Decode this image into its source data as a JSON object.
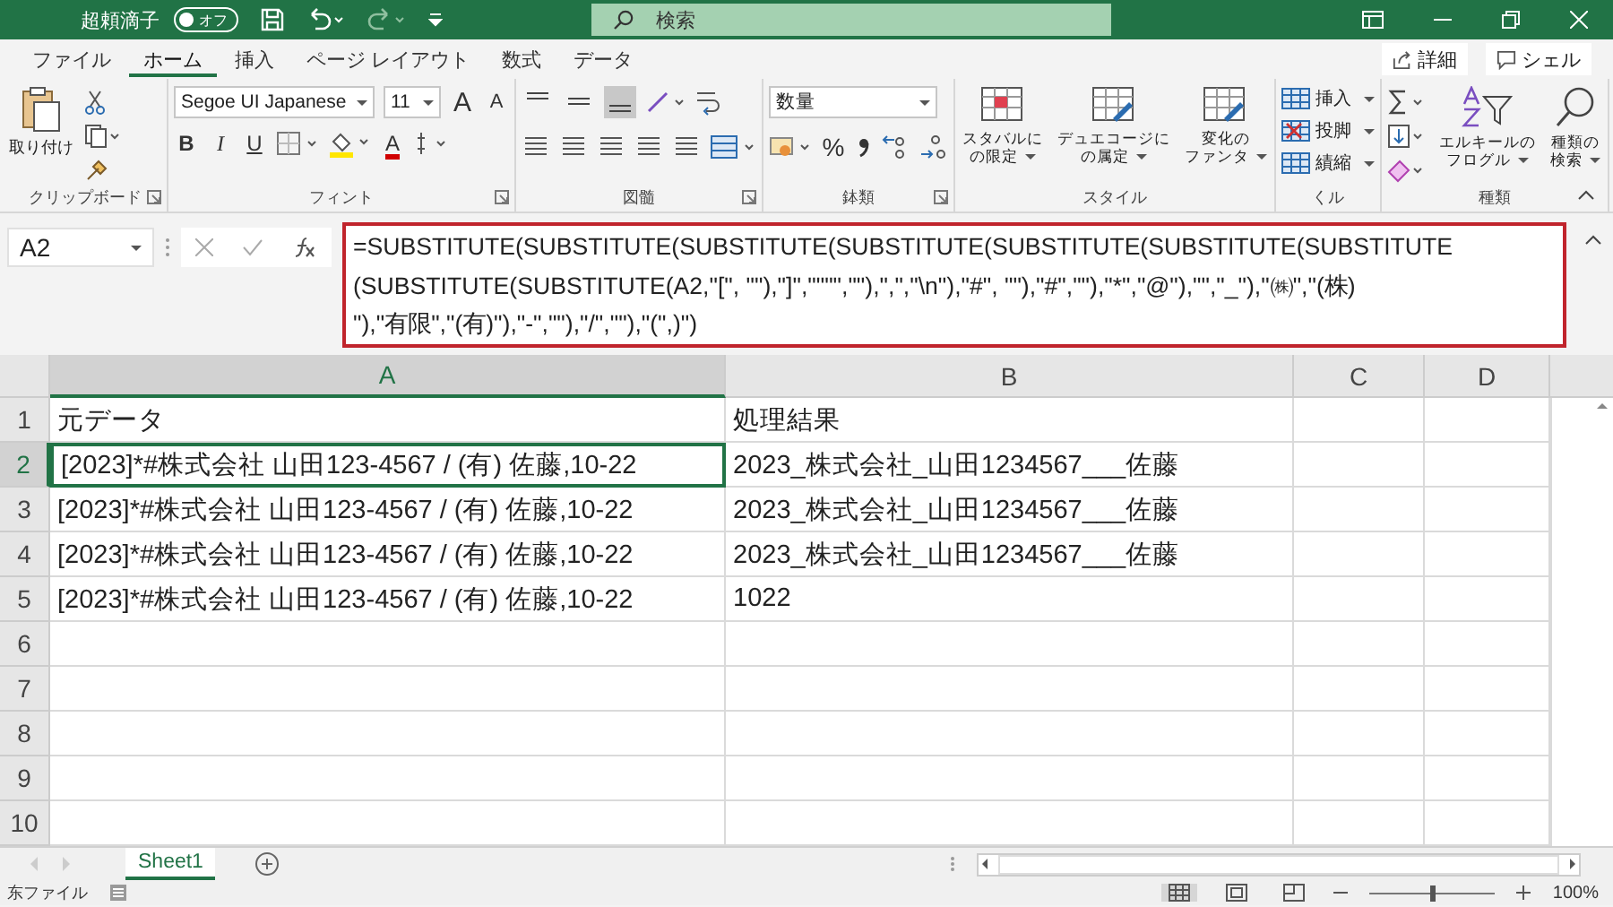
{
  "title_bar": {
    "user": "超頼滴子",
    "autosave": {
      "label": "オフ",
      "on": false
    },
    "search": {
      "placeholder": "検索"
    }
  },
  "ribbon_tabs": [
    {
      "label": "ファイル",
      "selected": false
    },
    {
      "label": "ホーム",
      "selected": true
    },
    {
      "label": "挿入",
      "selected": false
    },
    {
      "label": "ページ レイアウト",
      "selected": false
    },
    {
      "label": "数式",
      "selected": false
    },
    {
      "label": "データ",
      "selected": false
    }
  ],
  "share_buttons": [
    {
      "kind": "share",
      "label": "詳細"
    },
    {
      "kind": "comment",
      "label": "シェル"
    }
  ],
  "ribbon_groups": [
    {
      "kind": "clipboard",
      "label": "クリップボード",
      "paste": "取り付け"
    },
    {
      "kind": "font",
      "label": "フィント",
      "font_name": "Segoe UI Japanese",
      "font_size": "11",
      "grow": "A",
      "shrink": "A",
      "bold": "B",
      "italic": "I",
      "underline": "U",
      "font_color": "A"
    },
    {
      "kind": "alignment",
      "label": "図髓",
      "vertical_align": [
        {
          "selected": false
        },
        {
          "selected": false
        },
        {
          "selected": true
        }
      ]
    },
    {
      "kind": "number",
      "label": "鉢類",
      "format": "数量",
      "percent": "%"
    },
    {
      "kind": "styles",
      "label": "スタイル",
      "buttons": [
        [
          "スタバルに",
          "の限定"
        ],
        [
          "デュエコージに",
          "の属定"
        ],
        [
          "変化の",
          "ファンタ"
        ]
      ]
    },
    {
      "kind": "cells",
      "label": "くル",
      "buttons": [
        "挿入",
        "投脚",
        "績縮"
      ]
    },
    {
      "kind": "editing",
      "label": "種類",
      "buttons": [
        [
          "エルキールの",
          "フログル"
        ],
        [
          "種類の",
          "検索"
        ]
      ]
    }
  ],
  "formula_bar": {
    "name_box": "A2",
    "formula_lines": [
      "=SUBSTITUTE(SUBSTITUTE(SUBSTITUTE(SUBSTITUTE(SUBSTITUTE(SUBSTITUTE(SUBSTITUTE",
      "(SUBSTITUTE(SUBSTITUTE(A2,\"[\", \"\"),\"]\",\"\"\"\",\"\"),\",\",\"\\n\"),\"#\", \"\"),\"#\",\"\"),\"*\",\"@\"),\"\",\"_\"),\"㈱\",\"(株)",
      "\"),\"有限\",\"(有)\"),\"-\",\"\"),\"/\",\"\"),\"(\",)\")"
    ]
  },
  "sheet": {
    "columns": [
      {
        "label": "A",
        "selected": true
      },
      {
        "label": "B",
        "selected": false
      },
      {
        "label": "C",
        "selected": false
      },
      {
        "label": "D",
        "selected": false
      }
    ],
    "rows": [
      {
        "label": "1",
        "selected": false,
        "cells": [
          "元データ",
          "処理結果"
        ]
      },
      {
        "label": "2",
        "selected": true,
        "cells": [
          "[2023]*#株式会社 山田123-4567 / (有) 佐藤,10-22",
          "2023_株式会社_山田1234567___佐藤"
        ]
      },
      {
        "label": "3",
        "selected": false,
        "cells": [
          "[2023]*#株式会社 山田123-4567 / (有) 佐藤,10-22",
          "2023_株式会社_山田1234567___佐藤"
        ]
      },
      {
        "label": "4",
        "selected": false,
        "cells": [
          "[2023]*#株式会社 山田123-4567 / (有) 佐藤,10-22",
          "2023_株式会社_山田1234567___佐藤"
        ]
      },
      {
        "label": "5",
        "selected": false,
        "cells": [
          "[2023]*#株式会社 山田123-4567 / (有) 佐藤,10-22",
          "1022"
        ]
      },
      {
        "label": "6",
        "selected": false
      },
      {
        "label": "7",
        "selected": false
      },
      {
        "label": "8",
        "selected": false
      },
      {
        "label": "9",
        "selected": false
      },
      {
        "label": "10",
        "selected": false
      }
    ]
  },
  "sheet_tabs": [
    {
      "label": "Sheet1",
      "selected": true
    }
  ],
  "status_bar": {
    "mode": "东ファイル",
    "zoom": {
      "level": 0.5,
      "label": "100%"
    }
  }
}
